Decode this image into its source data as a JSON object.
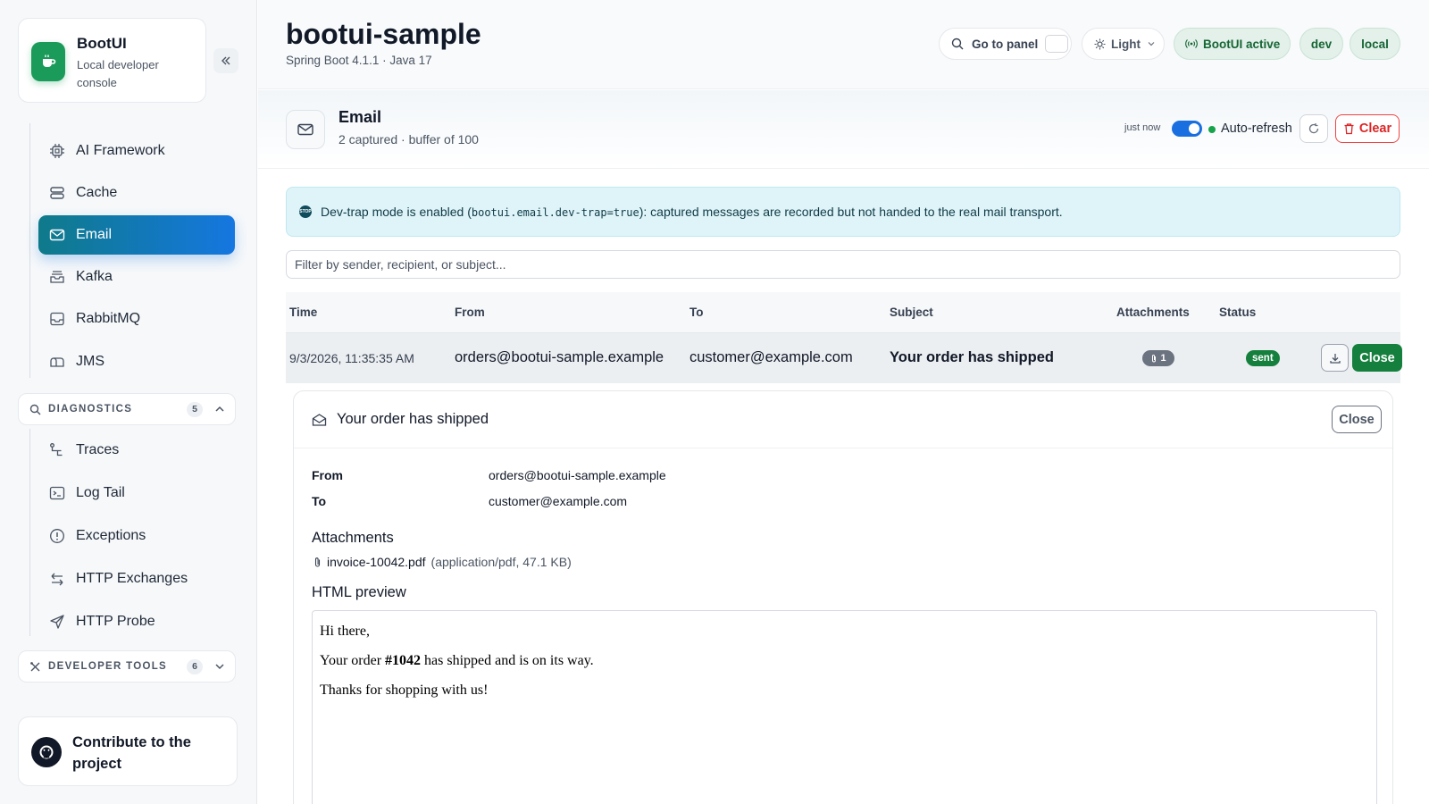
{
  "sidebar": {
    "brand_name": "BootUI",
    "brand_subtitle": "Local developer console",
    "nav_items": [
      {
        "label": "AI Framework",
        "icon": "chip-icon"
      },
      {
        "label": "Cache",
        "icon": "database-icon"
      },
      {
        "label": "Email",
        "icon": "envelope-icon",
        "active": true
      },
      {
        "label": "Kafka",
        "icon": "inbox-stack-icon"
      },
      {
        "label": "RabbitMQ",
        "icon": "inbox-icon"
      },
      {
        "label": "JMS",
        "icon": "mailbox-icon"
      }
    ],
    "diagnostics": {
      "title": "DIAGNOSTICS",
      "count": "5",
      "items": [
        {
          "label": "Traces",
          "icon": "trace-icon"
        },
        {
          "label": "Log Tail",
          "icon": "terminal-icon"
        },
        {
          "label": "Exceptions",
          "icon": "alert-circle-icon"
        },
        {
          "label": "HTTP Exchanges",
          "icon": "arrows-exchange-icon"
        },
        {
          "label": "HTTP Probe",
          "icon": "send-icon"
        }
      ]
    },
    "developer_tools": {
      "title": "DEVELOPER TOOLS",
      "count": "6"
    },
    "contribute_label": "Contribute to the project"
  },
  "header": {
    "app_title": "bootui-sample",
    "app_subtitle": "Spring Boot 4.1.1 · Java 17",
    "go_to_panel": "Go to panel",
    "theme": "Light",
    "status": "BootUI active",
    "profiles": [
      "dev",
      "local"
    ]
  },
  "email_panel": {
    "title": "Email",
    "subtitle": "2 captured · buffer of 100",
    "updated": "just now",
    "auto_refresh_label": "Auto-refresh",
    "auto_refresh_on": true,
    "clear_label": "Clear",
    "alert": {
      "before": "Dev-trap mode is enabled (",
      "code": "bootui.email.dev-trap=true",
      "after": "): captured messages are recorded but not handed to the real mail transport."
    },
    "filter_placeholder": "Filter by sender, recipient, or subject...",
    "columns": [
      "Time",
      "From",
      "To",
      "Subject",
      "Attachments",
      "Status"
    ],
    "rows": [
      {
        "time": "9/3/2026, 11:35:35 AM",
        "from": "orders@bootui-sample.example",
        "to": "customer@example.com",
        "subject": "Your order has shipped",
        "attachments": "1",
        "status": "sent",
        "close_label": "Close"
      }
    ],
    "detail": {
      "title": "Your order has shipped",
      "close_label": "Close",
      "from_label": "From",
      "from": "orders@bootui-sample.example",
      "to_label": "To",
      "to": "customer@example.com",
      "attachments_heading": "Attachments",
      "attachment_name": "invoice-10042.pdf",
      "attachment_meta": "(application/pdf, 47.1 KB)",
      "preview_heading": "HTML preview",
      "preview": {
        "greeting": "Hi there,",
        "line_before": "Your order ",
        "order_no": "#1042",
        "line_after": " has shipped and is on its way.",
        "closing": "Thanks for shopping with us!"
      }
    }
  },
  "colors": {
    "accent_gradient_start": "#0f7a8a",
    "accent_gradient_end": "#1577e0",
    "brand_green": "#1a9b5a",
    "status_green": "#15803d",
    "danger": "#dc2626",
    "info_bg": "#dff4f8"
  }
}
